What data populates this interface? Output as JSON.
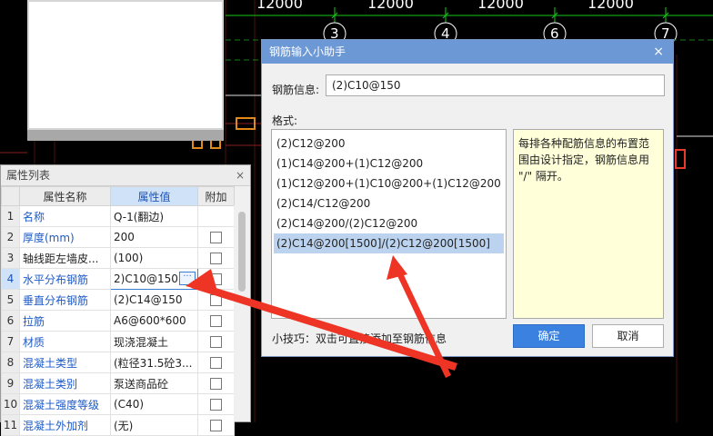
{
  "cad": {
    "dimensions": [
      "12000",
      "12000",
      "12000",
      "12000"
    ],
    "axis_labels": [
      "3",
      "4",
      "6",
      "7"
    ]
  },
  "property_panel": {
    "title": "属性列表",
    "close_glyph": "×",
    "columns": [
      "属性名称",
      "属性值",
      "附加"
    ],
    "rows": [
      {
        "idx": "1",
        "name": "名称",
        "value": "Q-1(翻边)",
        "name_blue": true,
        "has_check": false
      },
      {
        "idx": "2",
        "name": "厚度(mm)",
        "value": "200",
        "name_blue": true,
        "has_check": true
      },
      {
        "idx": "3",
        "name": "轴线距左墙皮...",
        "value": "(100)",
        "name_blue": false,
        "has_check": true
      },
      {
        "idx": "4",
        "name": "水平分布钢筋",
        "value": "2)C10@150",
        "name_blue": true,
        "has_check": true
      },
      {
        "idx": "5",
        "name": "垂直分布钢筋",
        "value": "(2)C14@150",
        "name_blue": true,
        "has_check": true
      },
      {
        "idx": "6",
        "name": "拉筋",
        "value": "A6@600*600",
        "name_blue": true,
        "has_check": true
      },
      {
        "idx": "7",
        "name": "材质",
        "value": "现浇混凝土",
        "name_blue": true,
        "has_check": true
      },
      {
        "idx": "8",
        "name": "混凝土类型",
        "value": "(粒径31.5砼3...",
        "name_blue": true,
        "has_check": true
      },
      {
        "idx": "9",
        "name": "混凝土类别",
        "value": "泵送商品砼",
        "name_blue": true,
        "has_check": true
      },
      {
        "idx": "10",
        "name": "混凝土强度等级",
        "value": "(C40)",
        "name_blue": true,
        "has_check": true
      },
      {
        "idx": "11",
        "name": "混凝土外加剂",
        "value": "(无)",
        "name_blue": true,
        "has_check": true
      }
    ],
    "ellipsis_glyph": "···"
  },
  "dialog": {
    "title": "钢筋输入小助手",
    "close_glyph": "×",
    "info_label": "钢筋信息:",
    "info_value": "(2)C10@150",
    "format_label": "格式:",
    "formats": [
      "(2)C12@200",
      "(1)C14@200+(1)C12@200",
      "(1)C12@200+(1)C10@200+(1)C12@200",
      "(2)C14/C12@200",
      "(2)C14@200/(2)C12@200",
      "(2)C14@200[1500]/(2)C12@200[1500]"
    ],
    "hint": "每排各种配筋信息的布置范围由设计指定，钢筋信息用 \"/\" 隔开。",
    "tip": "小技巧：双击可直接添加至钢筋信息",
    "ok_label": "确定",
    "cancel_label": "取消"
  },
  "colors": {
    "annotation_arrow": "#ee3424",
    "dialog_titlebar": "#6d98d6",
    "selected_row": "#bcd3ef",
    "hint_background": "#ffffd9",
    "ok_button": "#3b82e0"
  }
}
